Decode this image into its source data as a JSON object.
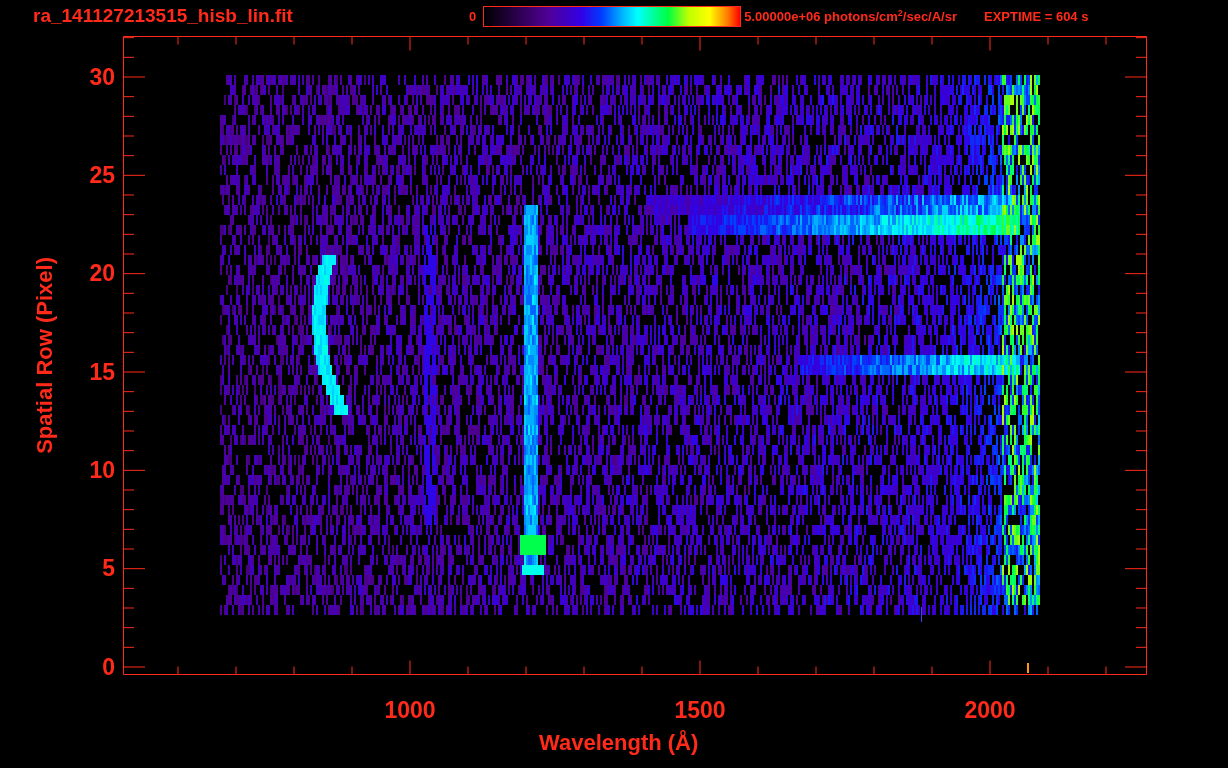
{
  "header": {
    "file_name": "ra_141127213515_hisb_lin.fit",
    "colorbar": {
      "min_label": "0",
      "max_label": "5.00000e+06 photons/cm$^{2}$/sec/A/sr"
    },
    "exposure": "EXPTIME = 604 s"
  },
  "plot": {
    "y_axis": {
      "title": "Spatial Row (Pixel)",
      "tick_labels": [
        "30",
        "25",
        "20",
        "15",
        "10",
        "5",
        "0"
      ]
    },
    "x_axis": {
      "title": "Wavelength (Å)",
      "tick_labels": [
        "1000",
        "1500",
        "2000"
      ]
    }
  }
}
